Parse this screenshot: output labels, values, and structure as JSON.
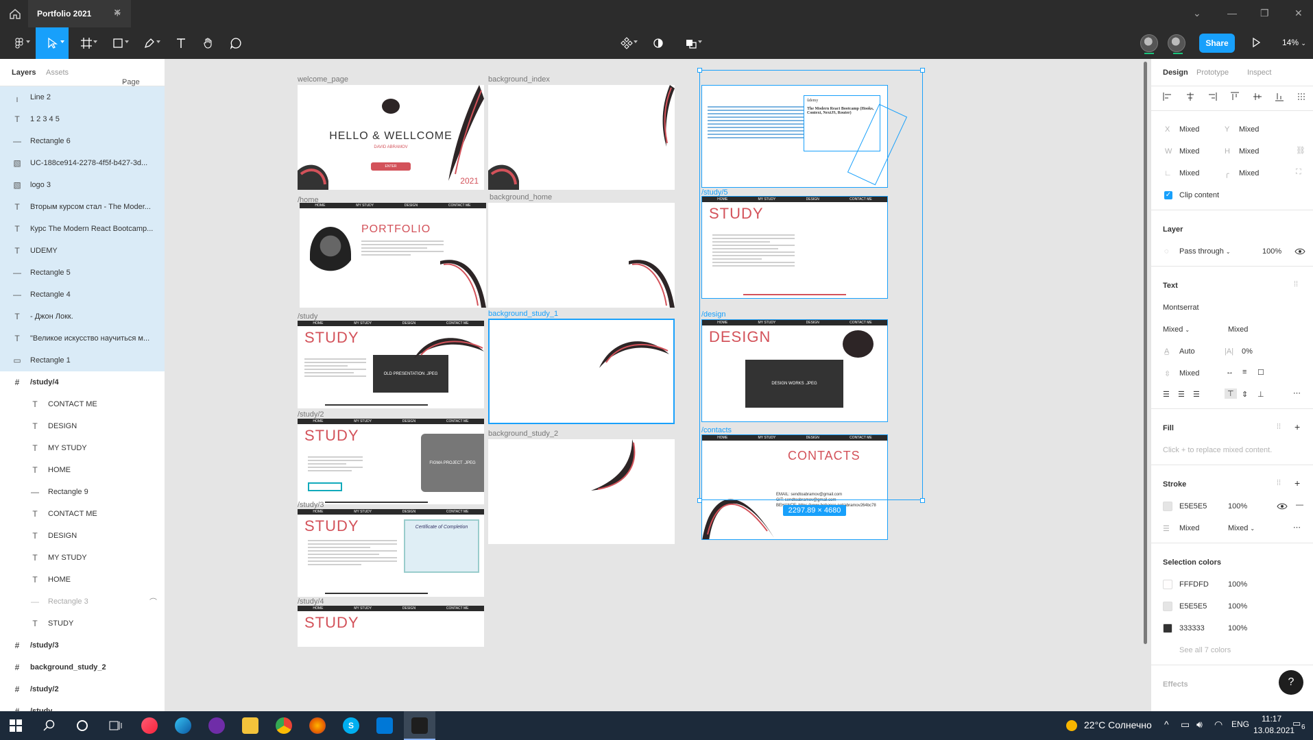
{
  "titlebar": {
    "tab_title": "Portfolio 2021",
    "close": "✕",
    "add": "+"
  },
  "toolbar": {
    "share": "Share",
    "zoom": "14%"
  },
  "layers_panel": {
    "tabs": {
      "layers": "Layers",
      "assets": "Assets",
      "page": "Page 1"
    },
    "items": [
      {
        "label": "Line 2",
        "icon": "line-icon",
        "glyph": "╷",
        "selected": true,
        "indent": 0
      },
      {
        "label": "1 2 3 4 5",
        "icon": "text-icon",
        "glyph": "T",
        "selected": true,
        "indent": 0
      },
      {
        "label": "Rectangle 6",
        "icon": "line-icon",
        "glyph": "—",
        "selected": true,
        "indent": 0
      },
      {
        "label": "UC-188ce914-2278-4f5f-b427-3d...",
        "icon": "image-icon",
        "glyph": "▧",
        "selected": true,
        "indent": 0
      },
      {
        "label": "logo 3",
        "icon": "image-icon",
        "glyph": "▧",
        "selected": true,
        "indent": 0
      },
      {
        "label": "Вторым курсом стал - The Moder...",
        "icon": "text-icon",
        "glyph": "T",
        "selected": true,
        "indent": 0
      },
      {
        "label": "Курс The Modern React Bootcamp...",
        "icon": "text-icon",
        "glyph": "T",
        "selected": true,
        "indent": 0
      },
      {
        "label": "UDEMY",
        "icon": "text-icon",
        "glyph": "T",
        "selected": true,
        "indent": 0
      },
      {
        "label": "Rectangle 5",
        "icon": "line-icon",
        "glyph": "—",
        "selected": true,
        "indent": 0
      },
      {
        "label": "Rectangle 4",
        "icon": "line-icon",
        "glyph": "—",
        "selected": true,
        "indent": 0
      },
      {
        "label": "- Джон Локк.",
        "icon": "text-icon",
        "glyph": "T",
        "selected": true,
        "indent": 0
      },
      {
        "label": "\"Великое искусство научиться м...",
        "icon": "text-icon",
        "glyph": "T",
        "selected": true,
        "indent": 0
      },
      {
        "label": "Rectangle 1",
        "icon": "rectangle-icon",
        "glyph": "▭",
        "selected": true,
        "indent": 0
      },
      {
        "label": "/study/4",
        "icon": "frame-icon",
        "glyph": "#",
        "selected": false,
        "indent": 0
      },
      {
        "label": "CONTACT ME",
        "icon": "text-icon",
        "glyph": "T",
        "selected": false,
        "indent": 1
      },
      {
        "label": "DESIGN",
        "icon": "text-icon",
        "glyph": "T",
        "selected": false,
        "indent": 1
      },
      {
        "label": "MY STUDY",
        "icon": "text-icon",
        "glyph": "T",
        "selected": false,
        "indent": 1
      },
      {
        "label": "HOME",
        "icon": "text-icon",
        "glyph": "T",
        "selected": false,
        "indent": 1
      },
      {
        "label": "Rectangle 9",
        "icon": "line-icon",
        "glyph": "—",
        "selected": false,
        "indent": 1
      },
      {
        "label": "CONTACT ME",
        "icon": "text-icon",
        "glyph": "T",
        "selected": false,
        "indent": 1
      },
      {
        "label": "DESIGN",
        "icon": "text-icon",
        "glyph": "T",
        "selected": false,
        "indent": 1
      },
      {
        "label": "MY STUDY",
        "icon": "text-icon",
        "glyph": "T",
        "selected": false,
        "indent": 1
      },
      {
        "label": "HOME",
        "icon": "text-icon",
        "glyph": "T",
        "selected": false,
        "indent": 1
      },
      {
        "label": "Rectangle 3",
        "icon": "line-icon",
        "glyph": "—",
        "selected": false,
        "indent": 1,
        "faded": true
      },
      {
        "label": "STUDY",
        "icon": "text-icon",
        "glyph": "T",
        "selected": false,
        "indent": 1
      },
      {
        "label": "/study/3",
        "icon": "frame-icon",
        "glyph": "#",
        "selected": false,
        "indent": 0
      },
      {
        "label": "background_study_2",
        "icon": "frame-icon",
        "glyph": "#",
        "selected": false,
        "indent": 0
      },
      {
        "label": "/study/2",
        "icon": "frame-icon",
        "glyph": "#",
        "selected": false,
        "indent": 0
      },
      {
        "label": "/study",
        "icon": "frame-icon",
        "glyph": "#",
        "selected": false,
        "indent": 0
      }
    ]
  },
  "props_panel": {
    "tabs": {
      "design": "Design",
      "prototype": "Prototype",
      "inspect": "Inspect"
    },
    "x_label": "X",
    "x_value": "Mixed",
    "y_label": "Y",
    "y_value": "Mixed",
    "w_label": "W",
    "w_value": "Mixed",
    "h_label": "H",
    "h_value": "Mixed",
    "rot_value": "Mixed",
    "radius_value": "Mixed",
    "clip_content": "Clip content",
    "layer_title": "Layer",
    "blend_mode": "Pass through",
    "layer_opacity": "100%",
    "text_title": "Text",
    "font_family": "Montserrat",
    "font_style": "Mixed",
    "font_size": "Mixed",
    "line_height": "Auto",
    "letter_spacing": "0%",
    "para_spacing": "Mixed",
    "fill_title": "Fill",
    "fill_hint": "Click + to replace mixed content.",
    "stroke_title": "Stroke",
    "stroke_color": "E5E5E5",
    "stroke_opacity": "100%",
    "stroke_weight": "Mixed",
    "stroke_align": "Mixed",
    "selection_colors_title": "Selection colors",
    "selection_colors": [
      {
        "hex": "FFFDFD",
        "opacity": "100%",
        "color": "#FFFDFD"
      },
      {
        "hex": "E5E5E5",
        "opacity": "100%",
        "color": "#E5E5E5"
      },
      {
        "hex": "333333",
        "opacity": "100%",
        "color": "#333333"
      }
    ],
    "see_all": "See all 7 colors",
    "effects_title": "Effects",
    "help": "?"
  },
  "canvas": {
    "selection_size": "2297.89 × 4680",
    "frames": {
      "welcome_page": {
        "label": "welcome_page",
        "hello": "HELLO & WELLCOME",
        "name": "DAVID ABRAMOV",
        "enter": "ENTER",
        "year": "2021"
      },
      "background_index": {
        "label": "background_index"
      },
      "home": {
        "label": "/home",
        "title": "PORTFOLIO"
      },
      "background_home": {
        "label": "background_home"
      },
      "study": {
        "label": "/study",
        "title": "STUDY",
        "box": "OLD PRESENTATION .JPEG"
      },
      "background_study_1": {
        "label": "background_study_1"
      },
      "study2": {
        "label": "/study/2",
        "title": "STUDY",
        "box": "FIGMA PROJECT .JPEG"
      },
      "background_study_2": {
        "label": "background_study_2"
      },
      "study3": {
        "label": "/study/3",
        "title": "STUDY",
        "cert": "Certificate of Completion"
      },
      "study4": {
        "label": "/study/4",
        "title": "STUDY"
      },
      "study5": {
        "label": "/study/5",
        "title": "STUDY",
        "course": "The Modern React Bootcamp (Hooks, Context, NextJS, Router)",
        "udemy": "ûdemy"
      },
      "design": {
        "label": "/design",
        "title": "DESIGN",
        "box": "DESIGN WORKS .JPEG"
      },
      "contacts": {
        "label": "/contacts",
        "title": "CONTACTS",
        "email": "EMAIL: sendtoabramov@gmail.com",
        "git": "GIT: sendtoabramov@gmail.com",
        "behance": "BEHANCE: https://www.behance.net/abramov264bc78"
      }
    },
    "nav": {
      "home": "HOME",
      "study": "MY STUDY",
      "design": "DESIGN",
      "contact": "CONTACT ME"
    }
  },
  "taskbar": {
    "weather": "22°C Солнечно",
    "lang": "ENG",
    "time": "11:17",
    "date": "13.08.2021",
    "notif": "6"
  },
  "colors": {
    "accent": "#18a0fb",
    "dark": "#2c2c2c",
    "brand_red": "#d3525a"
  }
}
